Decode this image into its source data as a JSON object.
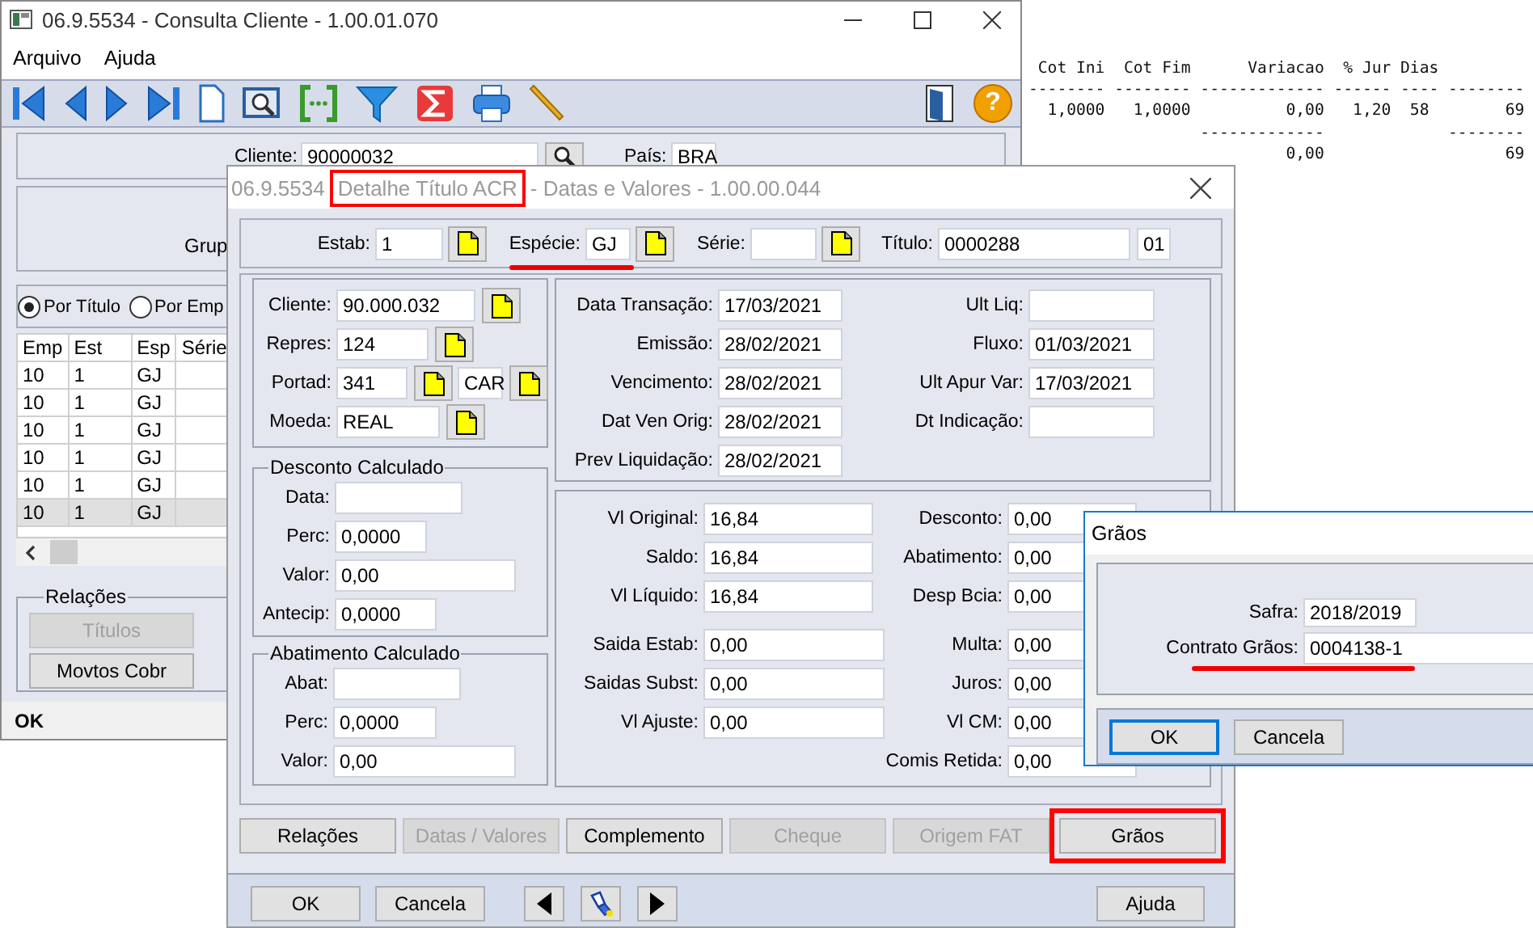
{
  "report": {
    "lines": [
      " Cot Ini  Cot Fim      Variacao  % Jur Dias",
      "-------- -------- ------------- ------ ---- --------",
      "  1,0000   1,0000          0,00   1,20  58        69",
      "                  -------------             --------",
      "                           0,00                   69"
    ]
  },
  "main_window": {
    "title": "06.9.5534 - Consulta Cliente - 1.00.01.070",
    "menu": [
      "Arquivo",
      "Ajuda"
    ],
    "help_glyph": "?",
    "cliente": {
      "label": "Cliente:",
      "value": "90000032"
    },
    "pais": {
      "label": "País:",
      "value": "BRA"
    },
    "grupo_label": "Grup",
    "radios": [
      {
        "label": "Por Título",
        "selected": true
      },
      {
        "label": "Por Emp",
        "selected": false
      }
    ],
    "grid": {
      "columns": [
        "Emp",
        "Est",
        "Esp",
        "Série"
      ],
      "rows": [
        {
          "cells": [
            "10",
            "1",
            "GJ"
          ],
          "selected": false
        },
        {
          "cells": [
            "10",
            "1",
            "GJ"
          ],
          "selected": false
        },
        {
          "cells": [
            "10",
            "1",
            "GJ"
          ],
          "selected": false
        },
        {
          "cells": [
            "10",
            "1",
            "GJ"
          ],
          "selected": false
        },
        {
          "cells": [
            "10",
            "1",
            "GJ"
          ],
          "selected": false
        },
        {
          "cells": [
            "10",
            "1",
            "GJ"
          ],
          "selected": true
        }
      ]
    },
    "relacoes": {
      "title": "Relações",
      "buttons": [
        {
          "label": "Títulos",
          "disabled": true
        },
        {
          "label": "Movtos Cobr",
          "disabled": false
        }
      ]
    },
    "status": "OK"
  },
  "detail_window": {
    "title_parts": [
      {
        "text": "06.9.5534",
        "boxed": false
      },
      {
        "text": "Detalhe Título ACR",
        "boxed": true
      },
      {
        "text": "- Datas e Valores - 1.00.00.044",
        "boxed": false
      }
    ],
    "header_fields": [
      {
        "label": "Estab:",
        "value": "1",
        "lookup": true,
        "underlined": false
      },
      {
        "label": "Espécie:",
        "value": "GJ",
        "lookup": true,
        "underlined": true
      },
      {
        "label": "Série:",
        "lookup": true,
        "underlined": false
      },
      {
        "label": "Título:",
        "value": "0000288",
        "lookup": false,
        "underlined": false
      },
      {
        "value": "01",
        "lookup": false,
        "underlined": false
      }
    ],
    "party_fields": [
      {
        "label": "Cliente:",
        "value": "90.000.032",
        "lookup": true
      },
      {
        "label": "Repres:",
        "value": "124",
        "lookup": true
      },
      {
        "label": "Portad:",
        "value": "341",
        "lookup": true,
        "extra_value": "CAR",
        "extra_lookup": true
      },
      {
        "label": "Moeda:",
        "value": "REAL",
        "lookup": true
      }
    ],
    "desconto": {
      "title": "Desconto Calculado",
      "fields": [
        {
          "label": "Data:"
        },
        {
          "label": "Perc:",
          "value": "0,0000"
        },
        {
          "label": "Valor:",
          "value": "0,00"
        },
        {
          "label": "Antecip:",
          "value": "0,0000"
        }
      ]
    },
    "abatimento": {
      "title": "Abatimento Calculado",
      "fields": [
        {
          "label": "Abat:"
        },
        {
          "label": "Perc:",
          "value": "0,0000"
        },
        {
          "label": "Valor:",
          "value": "0,00"
        }
      ]
    },
    "dates_left": [
      {
        "label": "Data Transação:",
        "value": "17/03/2021"
      },
      {
        "label": "Emissão:",
        "value": "28/02/2021"
      },
      {
        "label": "Vencimento:",
        "value": "28/02/2021"
      },
      {
        "label": "Dat Ven Orig:",
        "value": "28/02/2021"
      },
      {
        "label": "Prev Liquidação:",
        "value": "28/02/2021"
      }
    ],
    "dates_right": [
      {
        "label": "Ult Liq:"
      },
      {
        "label": "Fluxo:",
        "value": "01/03/2021"
      },
      {
        "label": "Ult Apur Var:",
        "value": "17/03/2021"
      },
      {
        "label": "Dt Indicação:"
      }
    ],
    "values_left": [
      {
        "label": "Vl Original:",
        "value": "16,84"
      },
      {
        "label": "Saldo:",
        "value": "16,84"
      },
      {
        "label": "Vl Líquido:",
        "value": "16,84"
      },
      {
        "label": "Saida Estab:",
        "value": "0,00"
      },
      {
        "label": "Saidas Subst:",
        "value": "0,00"
      },
      {
        "label": "Vl Ajuste:",
        "value": "0,00"
      }
    ],
    "values_right": [
      {
        "label": "Desconto:",
        "value": "0,00"
      },
      {
        "label": "Abatimento:",
        "value": "0,00"
      },
      {
        "label": "Desp Bcia:",
        "value": "0,00"
      },
      {
        "label": "Multa:",
        "value": "0,00"
      },
      {
        "label": "Juros:",
        "value": "0,00"
      },
      {
        "label": "Vl CM:",
        "value": "0,00"
      },
      {
        "label": "Comis Retida:",
        "value": "0,00"
      }
    ],
    "tabs": [
      {
        "label": "Relações",
        "disabled": false,
        "highlighted": false
      },
      {
        "label": "Datas / Valores",
        "disabled": true,
        "highlighted": false
      },
      {
        "label": "Complemento",
        "disabled": false,
        "highlighted": false
      },
      {
        "label": "Cheque",
        "disabled": true,
        "highlighted": false
      },
      {
        "label": "Origem FAT",
        "disabled": true,
        "highlighted": false
      },
      {
        "label": "Grãos",
        "disabled": false,
        "highlighted": true
      }
    ],
    "footer": {
      "ok": "OK",
      "cancel": "Cancela",
      "help": "Ajuda"
    }
  },
  "graos_dialog": {
    "title": "Grãos",
    "fields": [
      {
        "label": "Safra:",
        "value": "2018/2019",
        "underlined": false
      },
      {
        "label": "Contrato Grãos:",
        "value": "0004138-1",
        "underlined": true
      }
    ],
    "buttons": [
      {
        "label": "OK",
        "focused": true
      },
      {
        "label": "Cancela",
        "focused": false
      }
    ]
  }
}
